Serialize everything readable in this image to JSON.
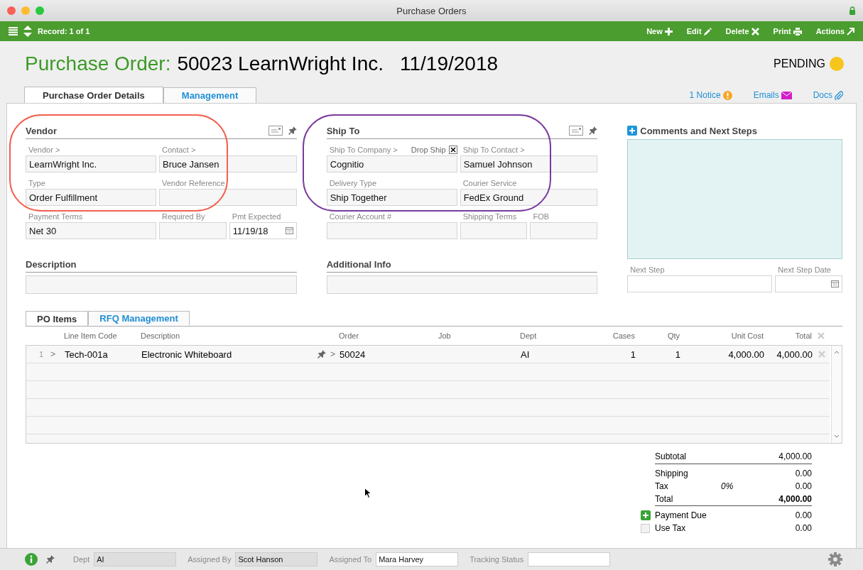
{
  "window": {
    "title": "Purchase Orders"
  },
  "toolbar": {
    "record": "Record: 1 of 1",
    "actions": [
      {
        "label": "New",
        "kind": "new"
      },
      {
        "label": "Edit",
        "kind": "edit"
      },
      {
        "label": "Delete",
        "kind": "delete"
      },
      {
        "label": "Print",
        "kind": "print"
      },
      {
        "label": "Actions",
        "kind": "actions"
      }
    ]
  },
  "header": {
    "title_label": "Purchase Order:",
    "record_name": "50023 LearnWright Inc.",
    "record_date": "11/19/2018",
    "status": "PENDING"
  },
  "tabs": [
    {
      "label": "Purchase Order Details",
      "selected": true
    },
    {
      "label": "Management",
      "selected": false
    }
  ],
  "links": [
    {
      "label": "1 Notice",
      "kind": "notice"
    },
    {
      "label": "Emails",
      "kind": "email"
    },
    {
      "label": "Docs",
      "kind": "docs"
    }
  ],
  "sections": [
    {
      "title": "Vendor",
      "rows": [
        [
          {
            "label": "Vendor >",
            "value": "LearnWright Inc."
          },
          {
            "label": "Contact >",
            "value": "Bruce Jansen"
          }
        ],
        [
          {
            "label": "Type",
            "value": "Order Fulfillment"
          },
          {
            "label": "Vendor Reference"
          }
        ],
        [
          {
            "label": "Payment Terms",
            "value": "Net 30"
          },
          {
            "label": "Required By"
          },
          {
            "label": "Pmt Expected",
            "value": "11/19/18",
            "kind": "date"
          }
        ]
      ]
    },
    {
      "title": "Ship To",
      "rows": [
        [
          {
            "label": "Ship To Company >",
            "value": "Cognitio",
            "flag": {
              "label": "Drop Ship",
              "checked": true
            }
          },
          {
            "label": "Ship To Contact >",
            "value": "Samuel Johnson"
          }
        ],
        [
          {
            "label": "Delivery Type",
            "value": "Ship Together"
          },
          {
            "label": "Courier Service",
            "value": "FedEx Ground"
          }
        ],
        [
          {
            "label": "Courier Account #"
          },
          {
            "label": "Shipping Terms"
          },
          {
            "label": "FOB"
          }
        ]
      ]
    }
  ],
  "comments": {
    "title": "Comments and Next Steps",
    "fields": [
      {
        "label": "Next Step"
      },
      {
        "label": "Next Step Date",
        "kind": "date"
      }
    ]
  },
  "notes": [
    {
      "title": "Description"
    },
    {
      "title": "Additional Info"
    }
  ],
  "item_tabs": [
    {
      "label": "PO Items",
      "selected": true
    },
    {
      "label": "RFQ Management",
      "selected": false
    }
  ],
  "table": {
    "columns": [
      {
        "label": "Line Item Code",
        "kind": "text"
      },
      {
        "label": "Description",
        "kind": "text"
      },
      {
        "label": "Order",
        "kind": "text"
      },
      {
        "label": "Job",
        "kind": "text"
      },
      {
        "label": "Dept",
        "kind": "text"
      },
      {
        "label": "Cases",
        "kind": "number"
      },
      {
        "label": "Qty",
        "kind": "number"
      },
      {
        "label": "Unit Cost",
        "kind": "number"
      },
      {
        "label": "Total",
        "kind": "number"
      }
    ],
    "rows": [
      {
        "number": "1",
        "code_chevron": ">",
        "order_chevron": ">",
        "cells": [
          "Tech-001a",
          "Electronic Whiteboard",
          "50024",
          null,
          "AI",
          "1",
          "1",
          "4,000.00",
          "4,000.00"
        ]
      }
    ]
  },
  "totals": [
    {
      "label": "Subtotal",
      "value": "4,000.00",
      "kind": "subtotal"
    },
    {
      "label": "Shipping",
      "value": "0.00",
      "kind": "line"
    },
    {
      "label": "Tax",
      "rate": "0%",
      "value": "0.00",
      "kind": "line"
    },
    {
      "label": "Total",
      "value": "4,000.00",
      "kind": "total"
    },
    {
      "label": "Payment Due",
      "value": "0.00",
      "kind": "add"
    },
    {
      "label": "Use Tax",
      "value": "0.00",
      "kind": "check",
      "checked": false
    }
  ],
  "footer": {
    "fields": [
      {
        "label": "Dept",
        "value": "AI",
        "disabled": true
      },
      {
        "label": "Assigned By",
        "value": "Scot Hanson",
        "disabled": true
      },
      {
        "label": "Assigned To",
        "value": "Mara Harvey",
        "disabled": false
      },
      {
        "label": "Tracking Status",
        "disabled": false
      }
    ]
  }
}
